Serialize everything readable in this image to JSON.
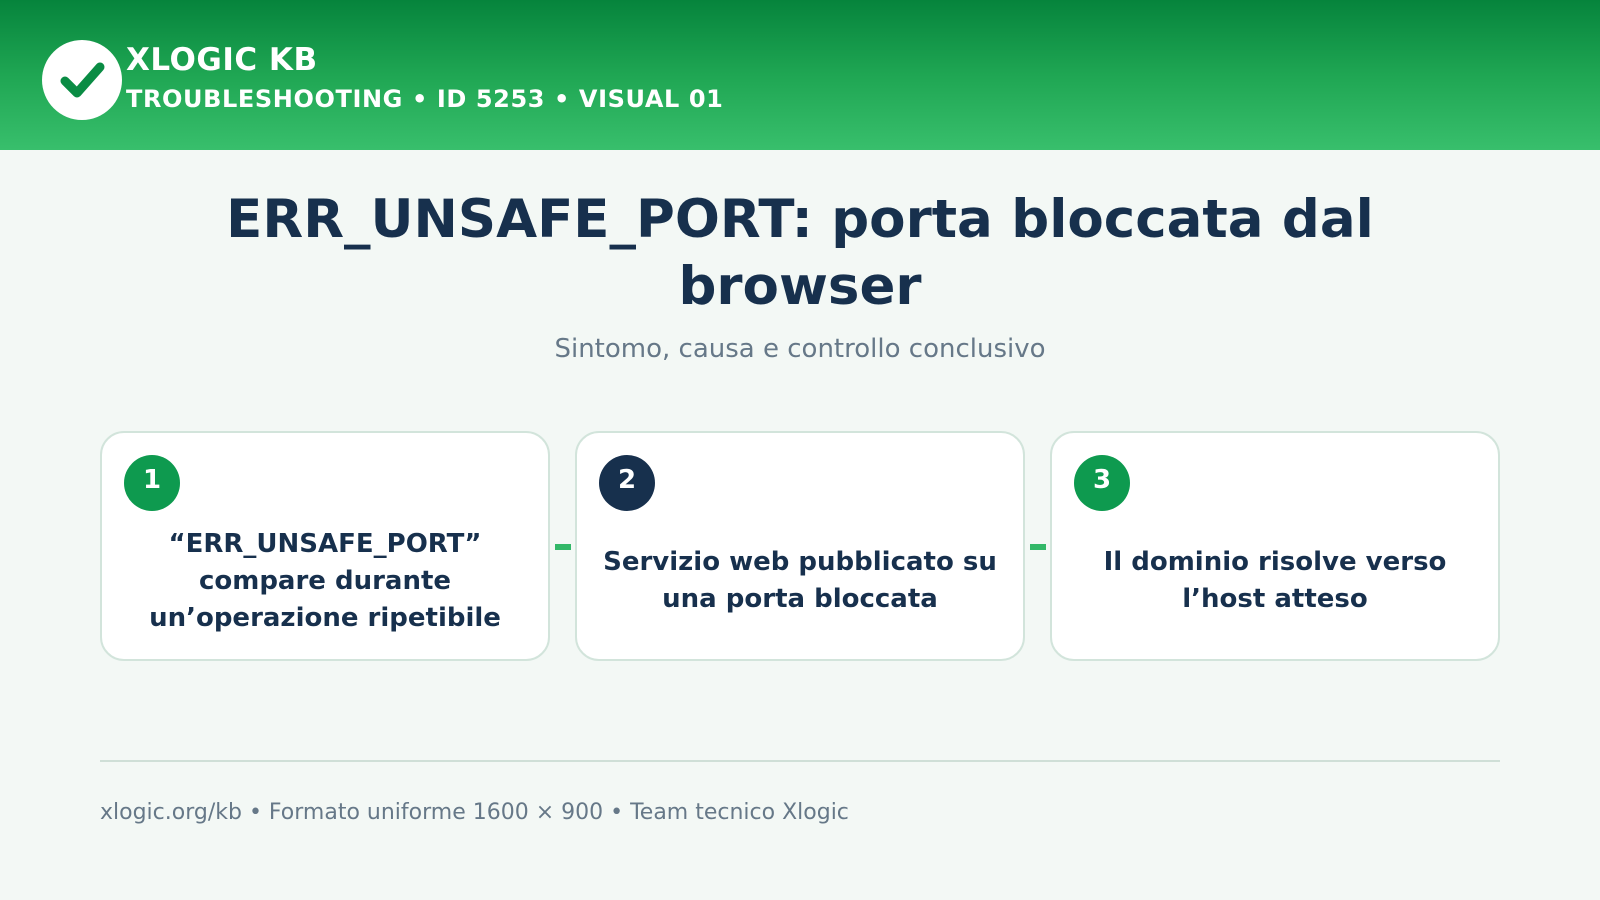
{
  "header": {
    "brand": "XLOGIC KB",
    "subtitle": "TROUBLESHOOTING • ID 5253 • VISUAL 01",
    "logo_icon": "checkmark-icon"
  },
  "main": {
    "title": "ERR_UNSAFE_PORT: porta bloccata dal browser",
    "subtitle": "Sintomo, causa e controllo conclusivo"
  },
  "steps": [
    {
      "number": "1",
      "text": "“ERR_UNSAFE_PORT” compare durante un’operazione ripetibile",
      "color": "#0e9a4f"
    },
    {
      "number": "2",
      "text": "Servizio web pubblicato su una porta bloccata",
      "color": "#17304d"
    },
    {
      "number": "3",
      "text": "Il dominio risolve verso l’host atteso",
      "color": "#0e9a4f"
    }
  ],
  "footer": {
    "text": "xlogic.org/kb • Formato uniforme 1600 × 900 • Team tecnico Xlogic"
  },
  "colors": {
    "header_green": "#1fa653",
    "accent_green": "#0e9a4f",
    "navy": "#17304d"
  }
}
